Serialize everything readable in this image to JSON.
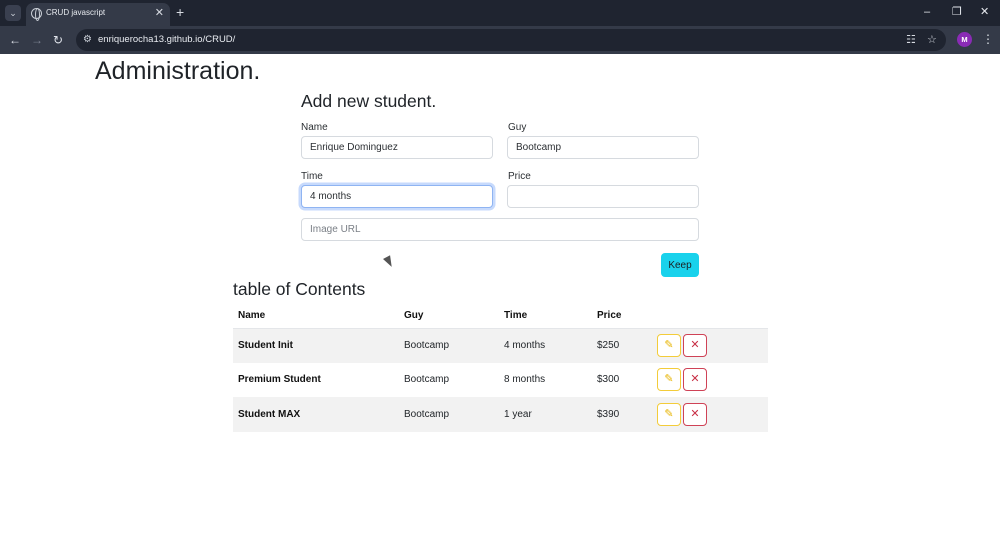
{
  "browser": {
    "tab_title": "CRUD javascript",
    "url": "enriquerocha13.github.io/CRUD/",
    "profile_initial": "M"
  },
  "page": {
    "title": "Administration.",
    "form_title": "Add new student.",
    "form": {
      "name_label": "Name",
      "name_value": "Enrique Dominguez",
      "guy_label": "Guy",
      "guy_value": "Bootcamp",
      "time_label": "Time",
      "time_value": "4 months",
      "price_label": "Price",
      "price_value": "",
      "image_placeholder": "Image URL",
      "keep_label": "Keep"
    },
    "table_title": "table of Contents",
    "table": {
      "headers": [
        "Name",
        "Guy",
        "Time",
        "Price"
      ],
      "rows": [
        [
          "Student Init",
          "Bootcamp",
          "4 months",
          "$250"
        ],
        [
          "Premium Student",
          "Bootcamp",
          "8 months",
          "$300"
        ],
        [
          "Student MAX",
          "Bootcamp",
          "1 year",
          "$390"
        ]
      ]
    }
  },
  "icons": {
    "tab_search": "chevron-down-icon",
    "edit": "pencil-icon",
    "delete": "close-icon"
  },
  "colors": {
    "keep_button": "#19d2ec",
    "edit_border": "#f3cc3a",
    "delete_border": "#cf4256"
  }
}
